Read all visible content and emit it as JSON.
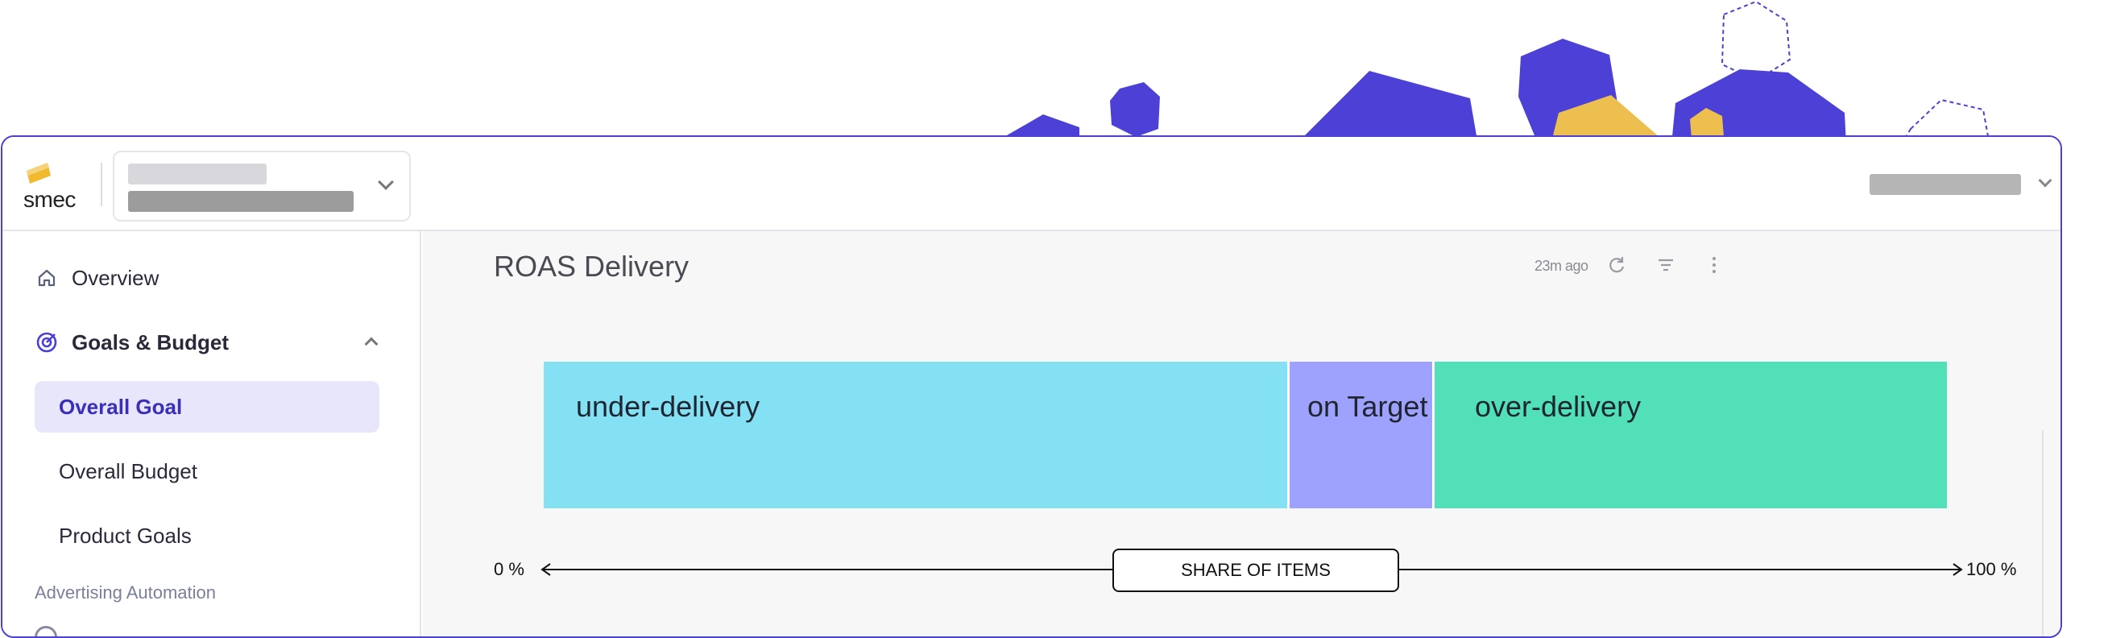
{
  "brand": {
    "logo_text": "smec",
    "logo_color": "#f0b92e"
  },
  "theme": {
    "accent": "#4b3fd6",
    "active_bg": "#e8e6fa",
    "deco_purple": "#4d40d6",
    "deco_yellow": "#ecbf4f"
  },
  "sidebar": {
    "overview_label": "Overview",
    "goals_label": "Goals & Budget",
    "sub_items": [
      "Overall Goal",
      "Overall Budget",
      "Product Goals"
    ],
    "section_label": "Advertising Automation"
  },
  "widget": {
    "title": "ROAS Delivery",
    "updated": "23m ago",
    "segments": [
      {
        "label": "under-delivery",
        "share_percent": 53,
        "color": "#84e1f4"
      },
      {
        "label": "on Target",
        "share_percent": 10.5,
        "color": "#9fa2fc"
      },
      {
        "label": "over-delivery",
        "share_percent": 36.5,
        "color": "#52e0b8"
      }
    ],
    "axis": {
      "min_label": "0 %",
      "max_label": "100 %",
      "title": "SHARE OF ITEMS"
    }
  },
  "icons": {
    "home": "home-icon",
    "goals": "target-icon",
    "refresh": "refresh-icon",
    "filter": "filter-icon",
    "more": "more-vertical-icon"
  }
}
